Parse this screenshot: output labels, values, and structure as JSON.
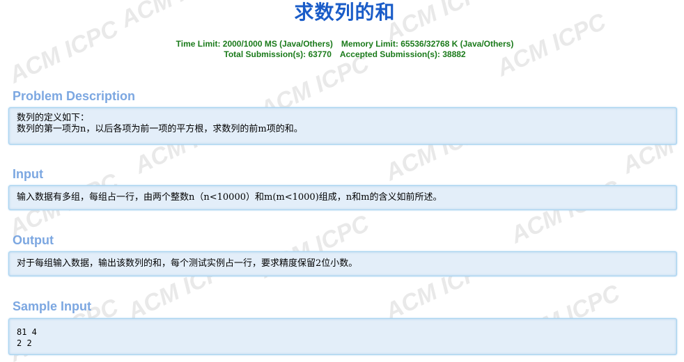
{
  "problem": {
    "title": "求数列的和",
    "time_limit": "Time Limit: 2000/1000 MS (Java/Others)",
    "memory_limit": "Memory Limit: 65536/32768 K (Java/Others)",
    "total_submissions": "Total Submission(s): 63770",
    "accepted_submissions": "Accepted Submission(s): 38882"
  },
  "watermark": {
    "text": "ACM ICPC"
  },
  "sections": {
    "description": {
      "heading": "Problem Description",
      "lines": [
        "数列的定义如下：",
        "数列的第一项为n，以后各项为前一项的平方根，求数列的前m项的和。"
      ]
    },
    "input": {
      "heading": "Input",
      "lines": [
        "输入数据有多组，每组占一行，由两个整数n（n<10000）和m(m<1000)组成，n和m的含义如前所述。"
      ]
    },
    "output": {
      "heading": "Output",
      "lines": [
        "对于每组输入数据，输出该数列的和，每个测试实例占一行，要求精度保留2位小数。"
      ]
    },
    "sample_input": {
      "heading": "Sample Input",
      "lines": [
        "81 4",
        "2 2"
      ]
    }
  }
}
